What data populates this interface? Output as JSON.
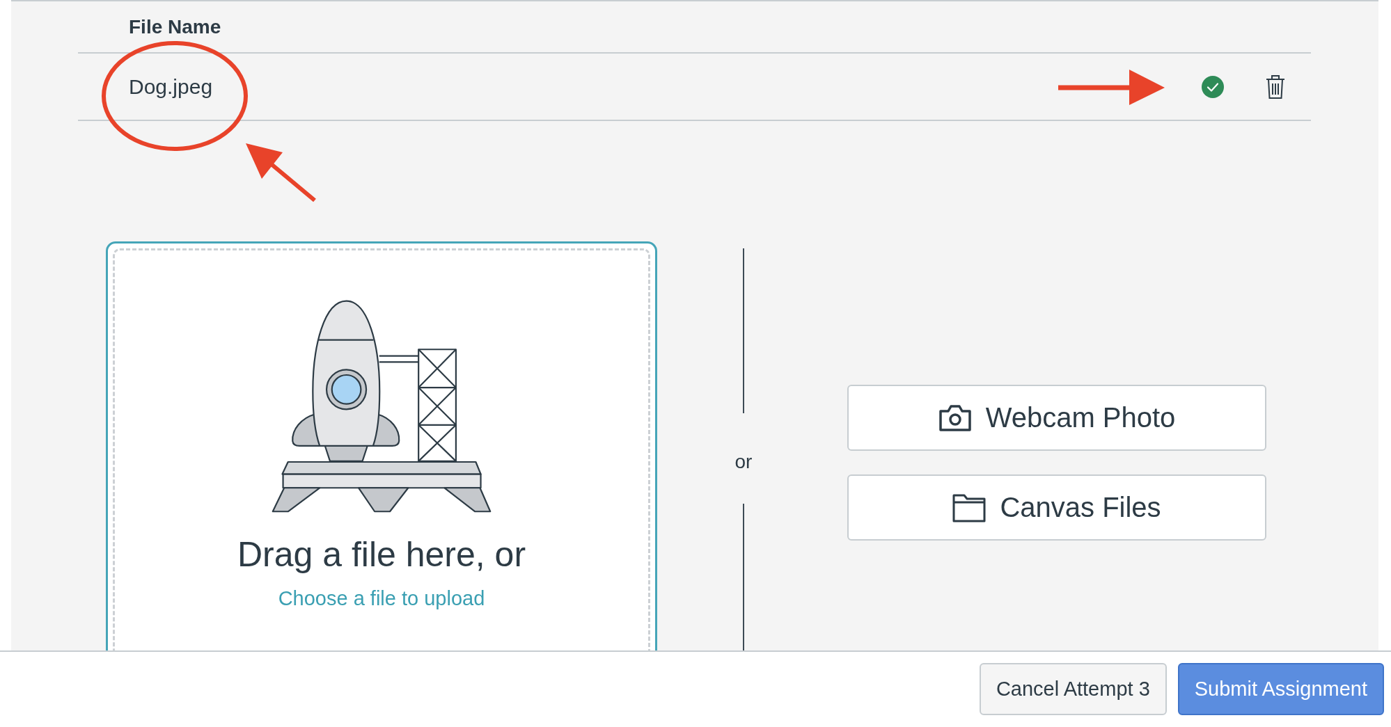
{
  "table": {
    "columns": [
      "File Name"
    ],
    "rows": [
      {
        "file_name": "Dog.jpeg",
        "uploaded": true
      }
    ]
  },
  "dropzone": {
    "heading": "Drag a file here, or",
    "link": "Choose a file to upload"
  },
  "divider": {
    "label": "or"
  },
  "sources": [
    {
      "kind": "webcam",
      "label": "Webcam Photo"
    },
    {
      "kind": "files",
      "label": "Canvas Files"
    }
  ],
  "footer": {
    "buttons": [
      {
        "label": "Cancel Attempt 3",
        "primary": false
      },
      {
        "label": "Submit Assignment",
        "primary": true
      }
    ]
  }
}
